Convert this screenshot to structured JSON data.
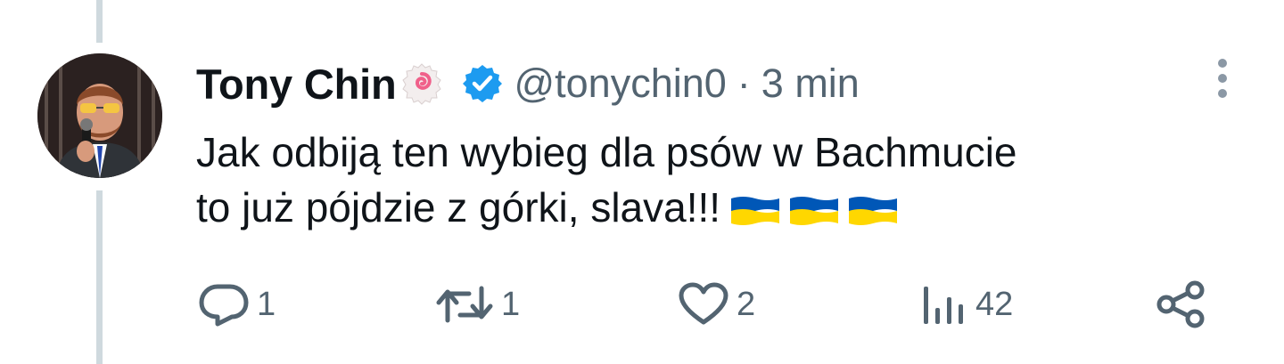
{
  "tweet": {
    "display_name": "Tony Chin",
    "handle": "@tonychin0",
    "separator": "·",
    "time": "3 min",
    "text_lines": [
      "Jak odbiją ten wybieg dla psów w Bachmucie",
      "to już pójdzie z górki, slava!!!"
    ],
    "flag_emoji_count": 3
  },
  "icons": {
    "name_badge": "narutomaki-emoji-icon",
    "verified": "verified-badge-icon",
    "more": "more-vertical-icon",
    "reply": "reply-icon",
    "retweet": "retweet-icon",
    "like": "like-heart-icon",
    "views": "views-chart-icon",
    "share": "share-icon"
  },
  "actions": {
    "reply_count": "1",
    "retweet_count": "1",
    "like_count": "2",
    "view_count": "42"
  },
  "colors": {
    "text": "#0f1419",
    "secondary": "#536471",
    "verified_blue": "#1d9bf0",
    "thread_line": "#cfd9de",
    "flag_blue": "#0057b7",
    "flag_yellow": "#ffd700"
  }
}
